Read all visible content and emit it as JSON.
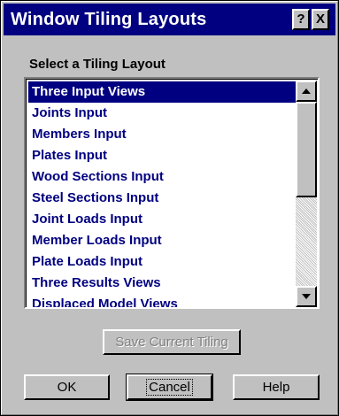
{
  "window": {
    "title": "Window Tiling Layouts",
    "help_button": "?",
    "close_button": "X"
  },
  "list": {
    "label": "Select a Tiling Layout",
    "selected_index": 0,
    "items": [
      {
        "label": "Three Input Views"
      },
      {
        "label": "Joints Input"
      },
      {
        "label": "Members Input"
      },
      {
        "label": "Plates Input"
      },
      {
        "label": "Wood Sections Input"
      },
      {
        "label": "Steel Sections Input"
      },
      {
        "label": "Joint Loads Input"
      },
      {
        "label": "Member Loads Input"
      },
      {
        "label": "Plate Loads Input"
      },
      {
        "label": "Three Results Views"
      },
      {
        "label": "Displaced Model Views"
      }
    ]
  },
  "buttons": {
    "save_label": "Save Current Tiling",
    "ok_label": "OK",
    "cancel_label": "Cancel",
    "help_label": "Help"
  },
  "colors": {
    "titlebar": "#000080",
    "selection": "#000080",
    "item_text": "#000080",
    "face": "#c0c0c0"
  }
}
